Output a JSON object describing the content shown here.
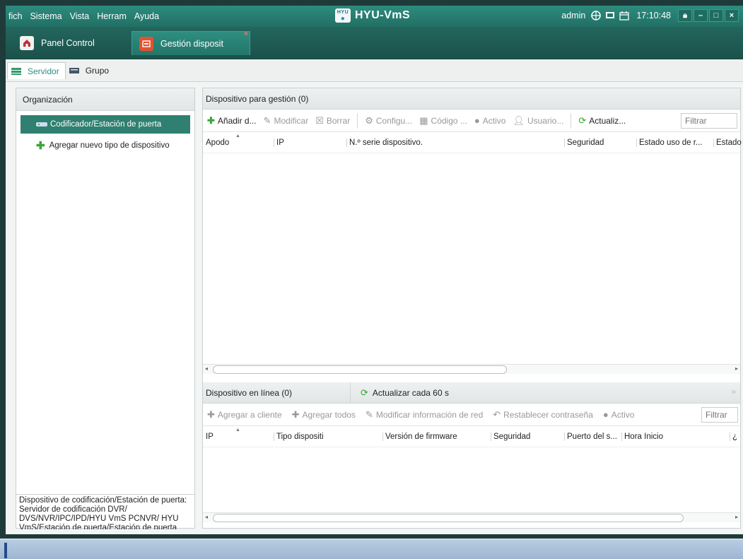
{
  "menu": [
    "fich",
    "Sistema",
    "Vista",
    "Herram",
    "Ayuda"
  ],
  "app": {
    "logo_top": "HYU",
    "title": "HYU-VmS"
  },
  "titlebar": {
    "user": "admin",
    "time": "17:10:48"
  },
  "tabs": {
    "panel_control": "Panel Control",
    "gestion": "Gestión disposit"
  },
  "subtabs": {
    "servidor": "Servidor",
    "grupo": "Grupo"
  },
  "organization": {
    "title": "Organización",
    "selected_item": "Codificador/Estación de puerta",
    "add_item": "Agregar nuevo tipo de dispositivo",
    "description": "Dispositivo de codificación/Estación de puerta: Servidor de codificación DVR/ DVS/NVR/IPC/IPD/HYU VmS PCNVR/ HYU VmS/Estación de puerta/Estación de puerta externa/Estación de puerta (serie V)"
  },
  "managed": {
    "title": "Dispositivo para gestión (0)",
    "toolbar": {
      "add": "Añadir d...",
      "modify": "Modificar",
      "delete": "Borrar",
      "config": "Configu...",
      "code": "Código ...",
      "active": "Activo",
      "user": "Usuario...",
      "refresh": "Actualiz...",
      "filter_placeholder": "Filtrar"
    },
    "columns": [
      "Apodo",
      "IP",
      "N.º serie dispositivo.",
      "Seguridad",
      "Estado uso de r...",
      "Estado"
    ]
  },
  "online": {
    "title": "Dispositivo en línea (0)",
    "refresh": "Actualizar cada 60 s",
    "toolbar": {
      "add_client": "Agregar a cliente",
      "add_all": "Agregar todos",
      "modify_net": "Modificar información de red",
      "reset_pwd": "Restablecer contraseña",
      "active": "Activo",
      "filter_placeholder": "Filtrar"
    },
    "columns": [
      "IP",
      "Tipo dispositi",
      "Versión de firmware",
      "Seguridad",
      "Puerto del s...",
      "Hora Inicio",
      "¿"
    ]
  },
  "colors": {
    "accent": "#2f8070",
    "titlebar": "#2c8c7f"
  }
}
